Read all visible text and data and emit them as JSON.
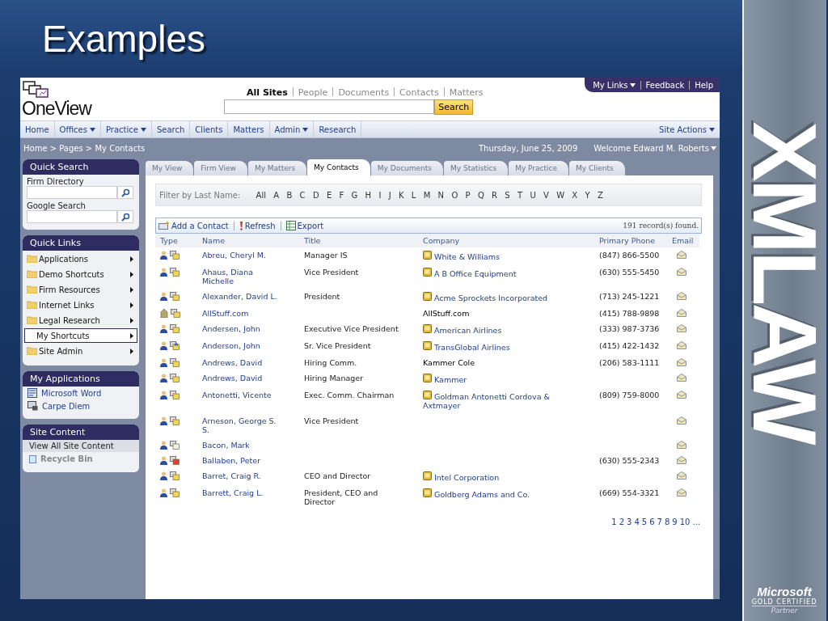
{
  "slide_title": "Examples",
  "top_links": [
    {
      "label": "My Links",
      "has_menu": true
    },
    {
      "label": "Feedback",
      "has_menu": false
    },
    {
      "label": "Help",
      "has_menu": false
    }
  ],
  "logo": {
    "text": "OneView"
  },
  "search": {
    "scopes": [
      {
        "label": "All Sites",
        "selected": true
      },
      {
        "label": "People",
        "selected": false
      },
      {
        "label": "Documents",
        "selected": false
      },
      {
        "label": "Contacts",
        "selected": false
      },
      {
        "label": "Matters",
        "selected": false
      }
    ],
    "button": "Search"
  },
  "nav": [
    {
      "label": "Home",
      "has_menu": false
    },
    {
      "label": "Offices",
      "has_menu": true
    },
    {
      "label": "Practice",
      "has_menu": true
    },
    {
      "label": "Search",
      "has_menu": false
    },
    {
      "label": "Clients",
      "has_menu": false
    },
    {
      "label": "Matters",
      "has_menu": false
    },
    {
      "label": "Admin",
      "has_menu": true
    },
    {
      "label": "Research",
      "has_menu": false
    }
  ],
  "site_actions": "Site Actions",
  "breadcrumb": "Home > Pages > My Contacts",
  "date": "Thursday, June 25, 2009",
  "welcome": "Welcome Edward M. Roberts",
  "quick_search": {
    "title": "Quick Search",
    "fields": [
      {
        "label": "Firm Directory"
      },
      {
        "label": "Google Search"
      }
    ]
  },
  "quick_links": {
    "title": "Quick Links",
    "items": [
      {
        "label": "Applications",
        "selected": false
      },
      {
        "label": "Demo Shortcuts",
        "selected": false
      },
      {
        "label": "Firm Resources",
        "selected": false
      },
      {
        "label": "Internet Links",
        "selected": false
      },
      {
        "label": "Legal Research",
        "selected": false
      },
      {
        "label": "My Shortcuts",
        "selected": true
      },
      {
        "label": "Site Admin",
        "selected": false
      }
    ]
  },
  "my_applications": {
    "title": "My Applications",
    "items": [
      {
        "label": "Microsoft Word",
        "kind": "word"
      },
      {
        "label": "Carpe Diem",
        "kind": "app"
      }
    ]
  },
  "site_content": {
    "title": "Site Content",
    "items": [
      "View All Site Content"
    ],
    "recycle_bin": "Recycle Bin"
  },
  "tabs": [
    {
      "label": "My View",
      "selected": false
    },
    {
      "label": "Firm View",
      "selected": false
    },
    {
      "label": "My Matters",
      "selected": false
    },
    {
      "label": "My Contacts",
      "selected": true
    },
    {
      "label": "My Documents",
      "selected": false
    },
    {
      "label": "My Statistics",
      "selected": false
    },
    {
      "label": "My Practice",
      "selected": false
    },
    {
      "label": "My Clients",
      "selected": false
    }
  ],
  "filter": {
    "label": "Filter by Last Name:",
    "letters": [
      "All",
      "A",
      "B",
      "C",
      "D",
      "E",
      "F",
      "G",
      "H",
      "I",
      "J",
      "K",
      "L",
      "M",
      "N",
      "O",
      "P",
      "Q",
      "R",
      "S",
      "T",
      "U",
      "V",
      "W",
      "X",
      "Y",
      "Z"
    ]
  },
  "toolbar": {
    "actions": [
      {
        "label": "Add a Contact",
        "kind": "add"
      },
      {
        "label": "Refresh",
        "kind": "refresh"
      },
      {
        "label": "Export",
        "kind": "export"
      }
    ],
    "records": "191 record(s) found."
  },
  "table": {
    "columns": [
      "Type",
      "Name",
      "Title",
      "Company",
      "Primary Phone",
      "Email"
    ],
    "rows": [
      {
        "kind": "person",
        "card": {
          "kind": "standard"
        },
        "name": "Abreu, Cheryl M.",
        "title": "Manager IS",
        "company": "White & Williams",
        "company_linked": true,
        "phone": "(847) 866-5500"
      },
      {
        "kind": "person",
        "card": {
          "kind": "standard"
        },
        "name": "Ahaus, Diana Michelle",
        "title": "Vice President",
        "company": "A B Office Equipment",
        "company_linked": true,
        "phone": "(630) 555-5450"
      },
      {
        "kind": "person",
        "card": {
          "kind": "standard"
        },
        "name": "Alexander, David L.",
        "title": "President",
        "company": "Acme Sprockets Incorporated",
        "company_linked": true,
        "phone": "(713) 245-1221"
      },
      {
        "kind": "company",
        "card": {
          "kind": "standard"
        },
        "name": "AllStuff.com",
        "company": "AllStuff.com",
        "company_linked": false,
        "phone": "(415) 788-9898"
      },
      {
        "kind": "person",
        "card": {
          "kind": "standard"
        },
        "name": "Andersen, John",
        "title": "Executive Vice President",
        "company": "American Airlines",
        "company_linked": true,
        "phone": "(333) 987-3736"
      },
      {
        "kind": "person",
        "card": {
          "kind": "shared"
        },
        "name": "Anderson, John",
        "title": "Sr. Vice President",
        "company": "TransGlobal Airlines",
        "company_linked": true,
        "phone": "(415) 422-1432"
      },
      {
        "kind": "person",
        "card": {
          "kind": "standard"
        },
        "name": "Andrews, David",
        "title": "Hiring Comm.",
        "company": "Kammer Cole",
        "company_linked": false,
        "phone": "(206) 583-1111"
      },
      {
        "kind": "person",
        "card": {
          "kind": "standard"
        },
        "name": "Andrews, David",
        "title": "Hiring Manager",
        "company": "Kammer",
        "company_linked": true
      },
      {
        "kind": "person",
        "card": {
          "kind": "standard"
        },
        "name": "Antonetti, Vicente",
        "title": "Exec. Comm. Chairman",
        "company": "Goldman Antonetti Cordova & Axtmayer",
        "company_linked": true,
        "phone": "(809) 759-8000"
      },
      {
        "kind": "person",
        "card": {
          "kind": "standard"
        },
        "name": "Arneson, George S. S.",
        "title": "Vice President"
      },
      {
        "kind": "person",
        "card": {
          "kind": "blank"
        },
        "name": "Bacon, Mark"
      },
      {
        "kind": "person",
        "card": {
          "kind": "red"
        },
        "name": "Ballaben, Peter",
        "phone": "(630) 555-2343"
      },
      {
        "kind": "person",
        "card": {
          "kind": "standard"
        },
        "name": "Barret, Craig R.",
        "title": "CEO and Director",
        "company": "Intel Corporation",
        "company_linked": true
      },
      {
        "kind": "person",
        "card": {
          "kind": "standard"
        },
        "name": "Barrett, Craig L.",
        "title": "President, CEO and Director",
        "company": "Goldberg Adams and Co.",
        "company_linked": true,
        "phone": "(669) 554-3321"
      }
    ]
  },
  "pages": [
    "1",
    "2",
    "3",
    "4",
    "5",
    "6",
    "7",
    "8",
    "9",
    "10",
    "..."
  ],
  "brand": {
    "text": "XMLAW",
    "partner_name": "Microsoft",
    "partner_level": "GOLD CERTIFIED",
    "partner_note": "Partner"
  }
}
